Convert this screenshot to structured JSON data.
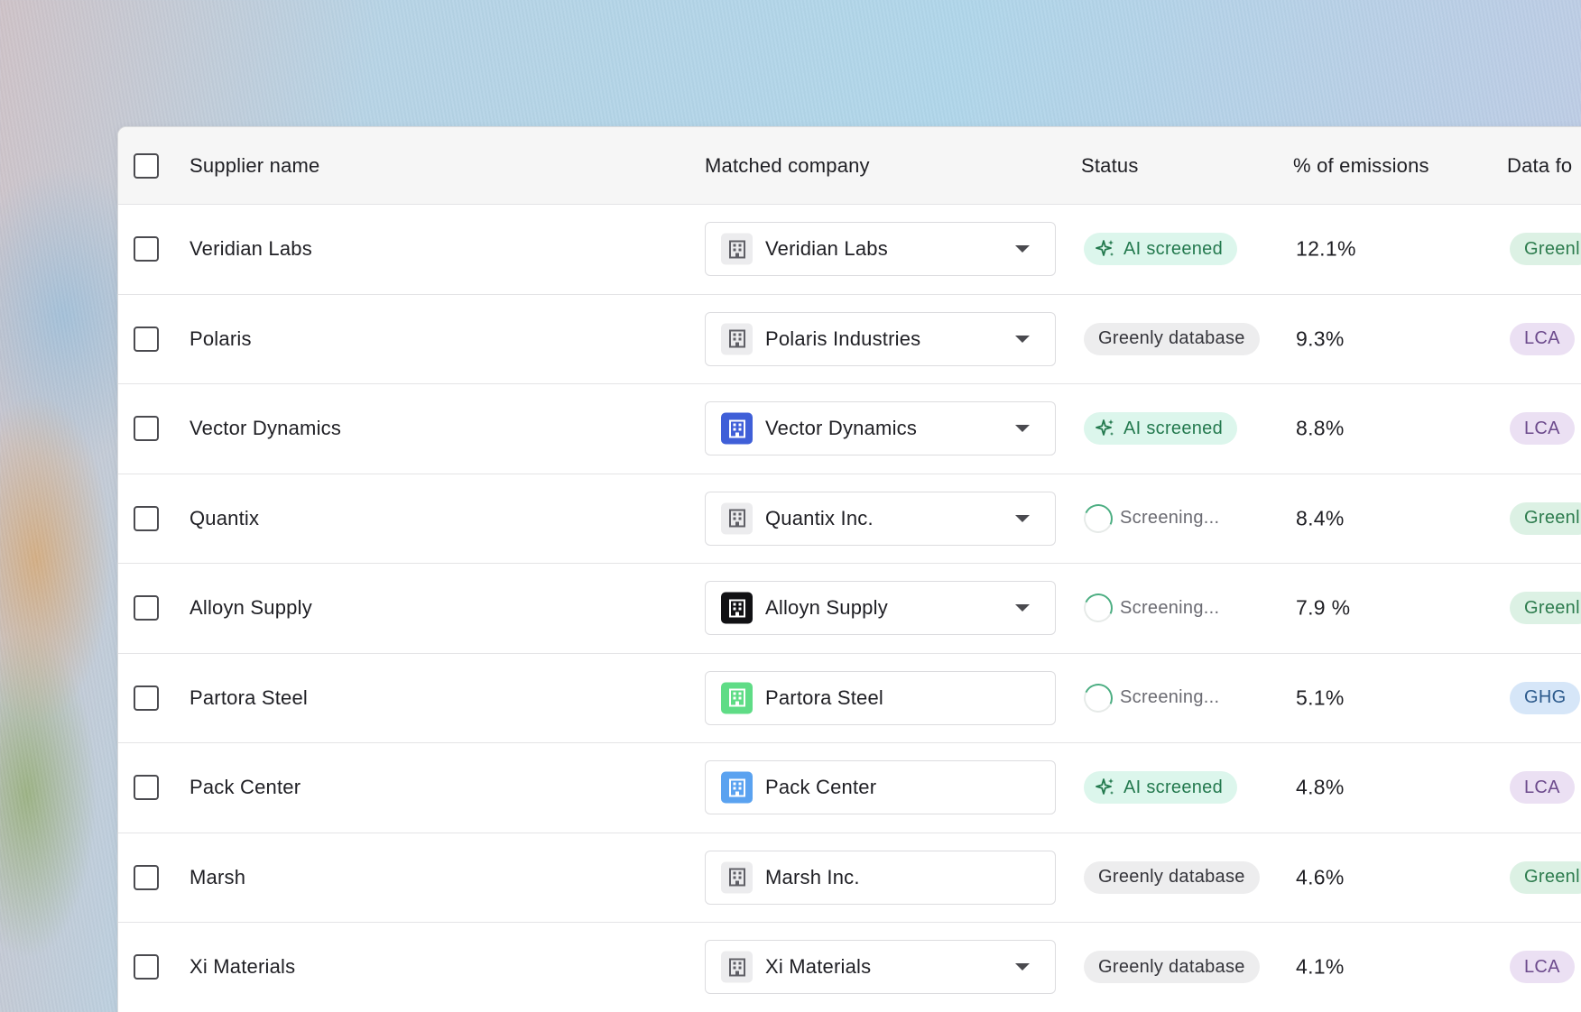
{
  "table": {
    "columns": {
      "supplier": "Supplier name",
      "matched": "Matched company",
      "status": "Status",
      "emissions": "% of emissions",
      "data_source": "Data fo"
    },
    "rows": [
      {
        "supplier": "Veridian Labs",
        "matched": "Veridian Labs",
        "logo_color": "#ececee",
        "icon_color": "#5f5f66",
        "dropdown": true,
        "status": "AI screened",
        "status_type": "ai",
        "pct": "12.1%",
        "source": "Greenl",
        "source_type": "green"
      },
      {
        "supplier": "Polaris",
        "matched": "Polaris Industries",
        "logo_color": "#ececee",
        "icon_color": "#5f5f66",
        "dropdown": true,
        "status": "Greenly database",
        "status_type": "db",
        "pct": "9.3%",
        "source": "LCA",
        "source_type": "lca"
      },
      {
        "supplier": "Vector Dynamics",
        "matched": "Vector Dynamics",
        "logo_color": "#3f5fd8",
        "icon_color": "#ffffff",
        "dropdown": true,
        "status": "AI screened",
        "status_type": "ai",
        "pct": "8.8%",
        "source": "LCA",
        "source_type": "lca"
      },
      {
        "supplier": "Quantix",
        "matched": "Quantix Inc.",
        "logo_color": "#ececee",
        "icon_color": "#5f5f66",
        "dropdown": true,
        "status": "Screening...",
        "status_type": "scr",
        "pct": "8.4%",
        "source": "Greenl",
        "source_type": "green"
      },
      {
        "supplier": "Alloyn Supply",
        "matched": "Alloyn Supply",
        "logo_color": "#111114",
        "icon_color": "#ffffff",
        "dropdown": true,
        "status": "Screening...",
        "status_type": "scr",
        "pct": "7.9 %",
        "source": "Greenl",
        "source_type": "green"
      },
      {
        "supplier": "Partora Steel",
        "matched": "Partora Steel",
        "logo_color": "#5fdc86",
        "icon_color": "#ffffff",
        "dropdown": false,
        "status": "Screening...",
        "status_type": "scr",
        "pct": "5.1%",
        "source": "GHG",
        "source_type": "ghg"
      },
      {
        "supplier": "Pack Center",
        "matched": "Pack Center",
        "logo_color": "#5aa2f0",
        "icon_color": "#ffffff",
        "dropdown": false,
        "status": "AI screened",
        "status_type": "ai",
        "pct": "4.8%",
        "source": "LCA",
        "source_type": "lca"
      },
      {
        "supplier": "Marsh",
        "matched": "Marsh Inc.",
        "logo_color": "#ececee",
        "icon_color": "#5f5f66",
        "dropdown": false,
        "status": "Greenly database",
        "status_type": "db",
        "pct": "4.6%",
        "source": "Greenl",
        "source_type": "green"
      },
      {
        "supplier": "Xi Materials",
        "matched": "Xi Materials",
        "logo_color": "#ececee",
        "icon_color": "#5f5f66",
        "dropdown": true,
        "status": "Greenly database",
        "status_type": "db",
        "pct": "4.1%",
        "source": "LCA",
        "source_type": "lca"
      }
    ]
  },
  "icons": {
    "company": "building-icon",
    "ai": "sparkle-icon",
    "screening": "spinner-icon",
    "dropdown": "chevron-down-icon"
  }
}
